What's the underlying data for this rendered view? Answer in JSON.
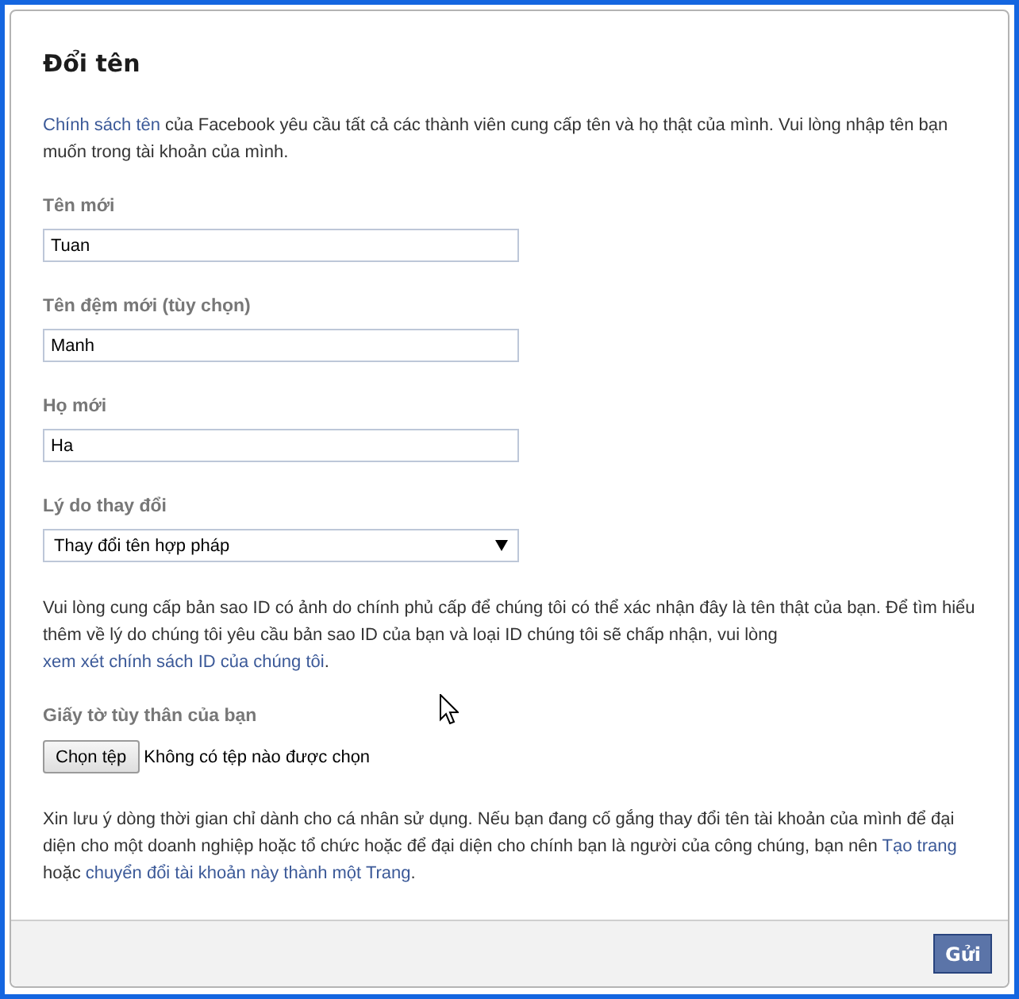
{
  "dialog": {
    "title": "Đổi tên"
  },
  "intro": [
    {
      "kind": "link",
      "text": "Chính sách tên"
    },
    {
      "kind": "text",
      "text": " của Facebook yêu cầu tất cả các thành viên cung cấp tên và họ thật của mình. Vui lòng nhập tên bạn muốn trong tài khoản của mình."
    }
  ],
  "fields": [
    {
      "kind": "text",
      "label": "Tên mới",
      "value": "Tuan"
    },
    {
      "kind": "text",
      "label": "Tên đệm mới (tùy chọn)",
      "value": "Manh"
    },
    {
      "kind": "text",
      "label": "Họ mới",
      "value": "Ha"
    },
    {
      "kind": "select",
      "label": "Lý do thay đổi",
      "value": "Thay đổi tên hợp pháp"
    }
  ],
  "id_notice": [
    {
      "kind": "text",
      "text": "Vui lòng cung cấp bản sao ID có ảnh do chính phủ cấp để chúng tôi có thể xác nhận đây là tên thật của bạn. Để tìm hiểu thêm về lý do chúng tôi yêu cầu bản sao ID của bạn và loại ID chúng tôi sẽ chấp nhận, vui lòng "
    },
    {
      "kind": "link",
      "text": "xem xét chính sách ID của chúng tôi"
    },
    {
      "kind": "text",
      "text": "."
    }
  ],
  "id_upload": {
    "label": "Giấy tờ tùy thân của bạn",
    "button": "Chọn tệp",
    "status": "Không có tệp nào được chọn"
  },
  "note": [
    {
      "kind": "text",
      "text": "Xin lưu ý dòng thời gian chỉ dành cho cá nhân sử dụng. Nếu bạn đang cố gắng thay đổi tên tài khoản của mình để đại diện cho một doanh nghiệp hoặc tổ chức hoặc để đại diện cho chính bạn là người của công chúng, bạn nên "
    },
    {
      "kind": "link",
      "text": "Tạo trang"
    },
    {
      "kind": "text",
      "text": " hoặc "
    },
    {
      "kind": "link",
      "text": "chuyển đổi tài khoản này thành một Trang"
    },
    {
      "kind": "text",
      "text": "."
    }
  ],
  "footer": {
    "submit": "Gửi"
  }
}
